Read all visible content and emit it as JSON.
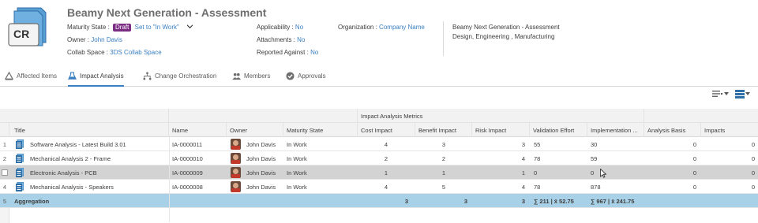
{
  "header": {
    "badge_text": "CR",
    "title": "Beamy Next Generation - Assessment",
    "maturity_label": "Maturity State :",
    "maturity_value": "Draft",
    "set_state_link": "Set to \"In Work\"",
    "owner_label": "Owner :",
    "owner_value": "John Davis",
    "collab_label": "Collab Space :",
    "collab_value": "3DS Collab Space",
    "applicability_label": "Applicability :",
    "applicability_value": "No",
    "attachments_label": "Attachments :",
    "attachments_value": "No",
    "reported_label": "Reported Against :",
    "reported_value": "No",
    "organization_label": "Organization :",
    "organization_value": "Company Name",
    "description_line1": "Beamy Next Generation - Assessment",
    "description_line2": "Design, Engineering , Manufacturing"
  },
  "tabs": [
    {
      "label": "Affected Items",
      "icon": "affected-items-icon"
    },
    {
      "label": "Impact Analysis",
      "icon": "impact-analysis-icon",
      "active": true
    },
    {
      "label": "Change Orchestration",
      "icon": "orchestration-icon"
    },
    {
      "label": "Members",
      "icon": "members-icon"
    },
    {
      "label": "Approvals",
      "icon": "approvals-icon"
    }
  ],
  "grid": {
    "group_header": "Impact Analysis Metrics",
    "columns": [
      "Title",
      "Name",
      "Owner",
      "Maturity State",
      "Cost Impact",
      "Benefit Impact",
      "Risk Impact",
      "Validation Effort",
      "Implementation ...",
      "Analysis Basis",
      "Impacts"
    ],
    "rows": [
      {
        "index": "1",
        "title": "Software Analysis - Latest Build 3.01",
        "name": "IA-0000011",
        "owner": "John Davis",
        "state": "In Work",
        "cost": "4",
        "benefit": "3",
        "risk": "3",
        "validation": "55",
        "implementation": "30",
        "basis": "0",
        "impacts": "0"
      },
      {
        "index": "2",
        "title": "Mechanical Analysis 2 - Frame",
        "name": "IA-0000010",
        "owner": "John Davis",
        "state": "In Work",
        "cost": "2",
        "benefit": "2",
        "risk": "4",
        "validation": "78",
        "implementation": "59",
        "basis": "0",
        "impacts": "0"
      },
      {
        "index": "",
        "title": "Electronic Analysis - PCB",
        "name": "IA-0000009",
        "owner": "John Davis",
        "state": "In Work",
        "cost": "1",
        "benefit": "1",
        "risk": "1",
        "validation": "0",
        "implementation": "0",
        "basis": "0",
        "impacts": "0"
      },
      {
        "index": "4",
        "title": "Mechanical Analysis - Speakers",
        "name": "IA-0000008",
        "owner": "John Davis",
        "state": "In Work",
        "cost": "4",
        "benefit": "5",
        "risk": "4",
        "validation": "78",
        "implementation": "878",
        "basis": "0",
        "impacts": "0"
      }
    ],
    "aggregation": {
      "index": "5",
      "title": "Aggregation",
      "cost": "3",
      "benefit": "3",
      "risk": "3",
      "validation": "∑ 211 | x̄ 52.75",
      "implementation": "∑ 967 | x̄ 241.75"
    }
  },
  "colors": {
    "accent": "#3a7fc1",
    "draft": "#7b2d83",
    "aggregation_row": "#a8d0e6",
    "selected_row": "#d3d3d3"
  }
}
